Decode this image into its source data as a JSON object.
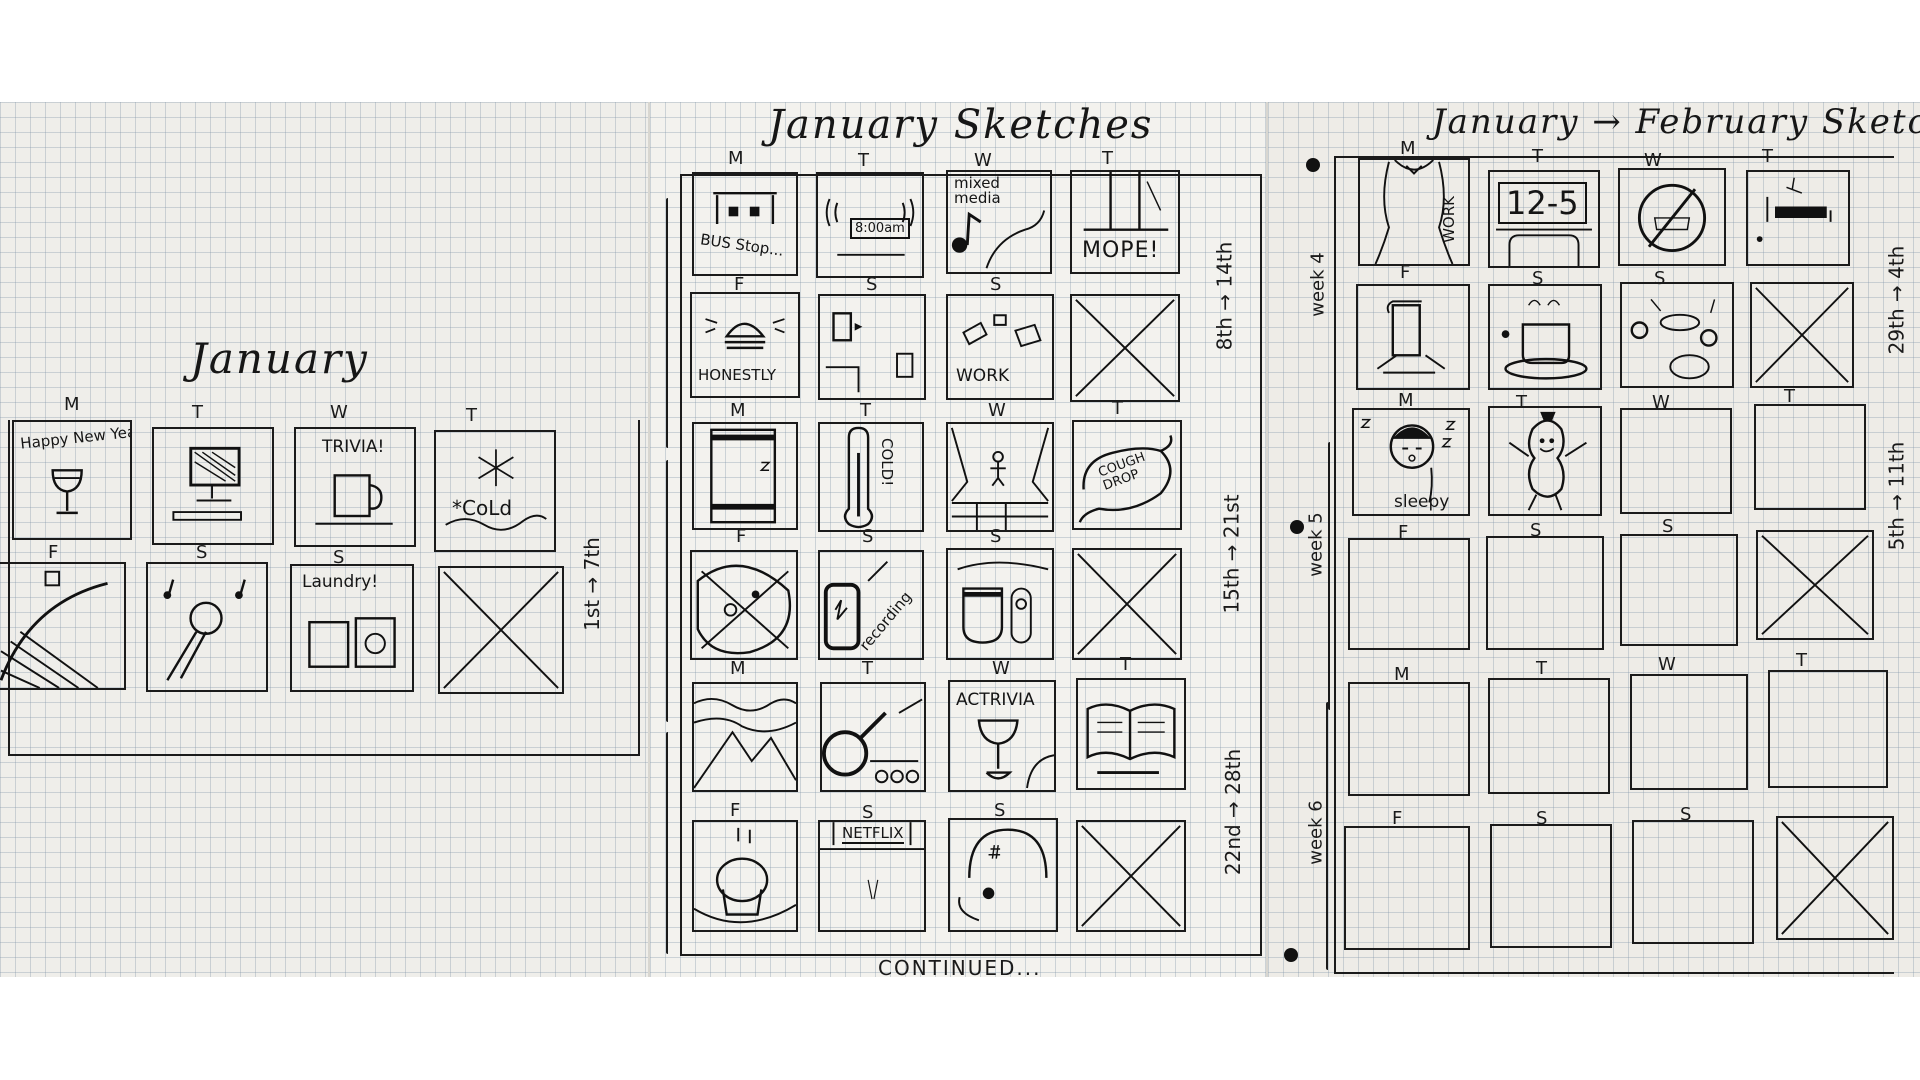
{
  "page1": {
    "title": "January",
    "day_labels_top": [
      "M",
      "T",
      "W",
      "T"
    ],
    "day_labels_bottom": [
      "F",
      "S",
      "S"
    ],
    "range": "1st → 7th",
    "captions": [
      "Happy New Year!",
      "TRIVIA!",
      "*CoLd",
      "Laundry!"
    ]
  },
  "page2": {
    "title": "January Sketches",
    "day_labels_top": [
      "M",
      "T",
      "W",
      "T"
    ],
    "day_labels_bottom": [
      "F",
      "S",
      "S"
    ],
    "ranges": [
      "8th → 14th",
      "15th → 21st",
      "22nd → 28th"
    ],
    "captions": [
      "BUS Stop...",
      "8:00am",
      "mixed media",
      "MOPE!",
      "HONESTLY",
      "WORK",
      "COLD!",
      "COUGH DROP",
      "recording",
      "ACTRIVIA",
      "NETFLIX"
    ],
    "footer": "CONTINUED..."
  },
  "page3": {
    "title": "January → February Sketches",
    "day_labels_top": [
      "M",
      "T",
      "W",
      "T"
    ],
    "day_labels_bottom": [
      "F",
      "S",
      "S"
    ],
    "weeks": [
      "week 4",
      "week 5",
      "week 6"
    ],
    "ranges": [
      "29th → 4th",
      "5th → 11th"
    ],
    "captions": [
      "WORK",
      "12-5",
      "sleepy"
    ]
  }
}
